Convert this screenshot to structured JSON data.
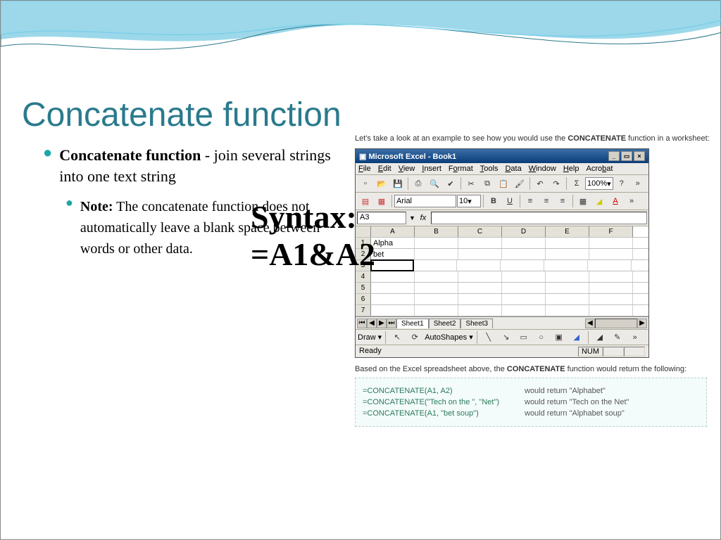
{
  "title": "Concatenate function",
  "bullet_main": {
    "bold": "Concatenate function",
    "rest": " - join several strings into one text string"
  },
  "bullet_sub": {
    "bold": "Note:",
    "rest": " The concatenate function does not automatically leave a blank space between words or other data."
  },
  "syntax": {
    "line1": "Syntax:",
    "line2": "=A1&A2"
  },
  "intro": {
    "pre": "Let's take a look at an example to see how you would use the ",
    "b": "CONCATENATE",
    "post": " function in a worksheet:"
  },
  "outro": {
    "pre": "Based on the Excel spreadsheet above, the ",
    "b": "CONCATENATE",
    "post": " function would return the following:"
  },
  "excel": {
    "title": "Microsoft Excel - Book1",
    "menu": [
      "File",
      "Edit",
      "View",
      "Insert",
      "Format",
      "Tools",
      "Data",
      "Window",
      "Help",
      "Acrobat"
    ],
    "zoom": "100%",
    "font": "Arial",
    "fsize": "10",
    "nameBox": "A3",
    "cols": [
      "A",
      "B",
      "C",
      "D",
      "E",
      "F"
    ],
    "rows": [
      "1",
      "2",
      "3",
      "4",
      "5",
      "6",
      "7"
    ],
    "data": {
      "1A": "Alpha",
      "2A": "bet"
    },
    "sheets": [
      "Sheet1",
      "Sheet2",
      "Sheet3"
    ],
    "draw": "Draw",
    "autoshapes": "AutoShapes",
    "ready": "Ready",
    "num": "NUM"
  },
  "examples": [
    {
      "fn": "=CONCATENATE(A1, A2)",
      "res": "would return \"Alphabet\""
    },
    {
      "fn": "=CONCATENATE(\"Tech on the \", \"Net\")",
      "res": "would return \"Tech on the Net\""
    },
    {
      "fn": "=CONCATENATE(A1, \"bet soup\")",
      "res": "would return \"Alphabet soup\""
    }
  ]
}
